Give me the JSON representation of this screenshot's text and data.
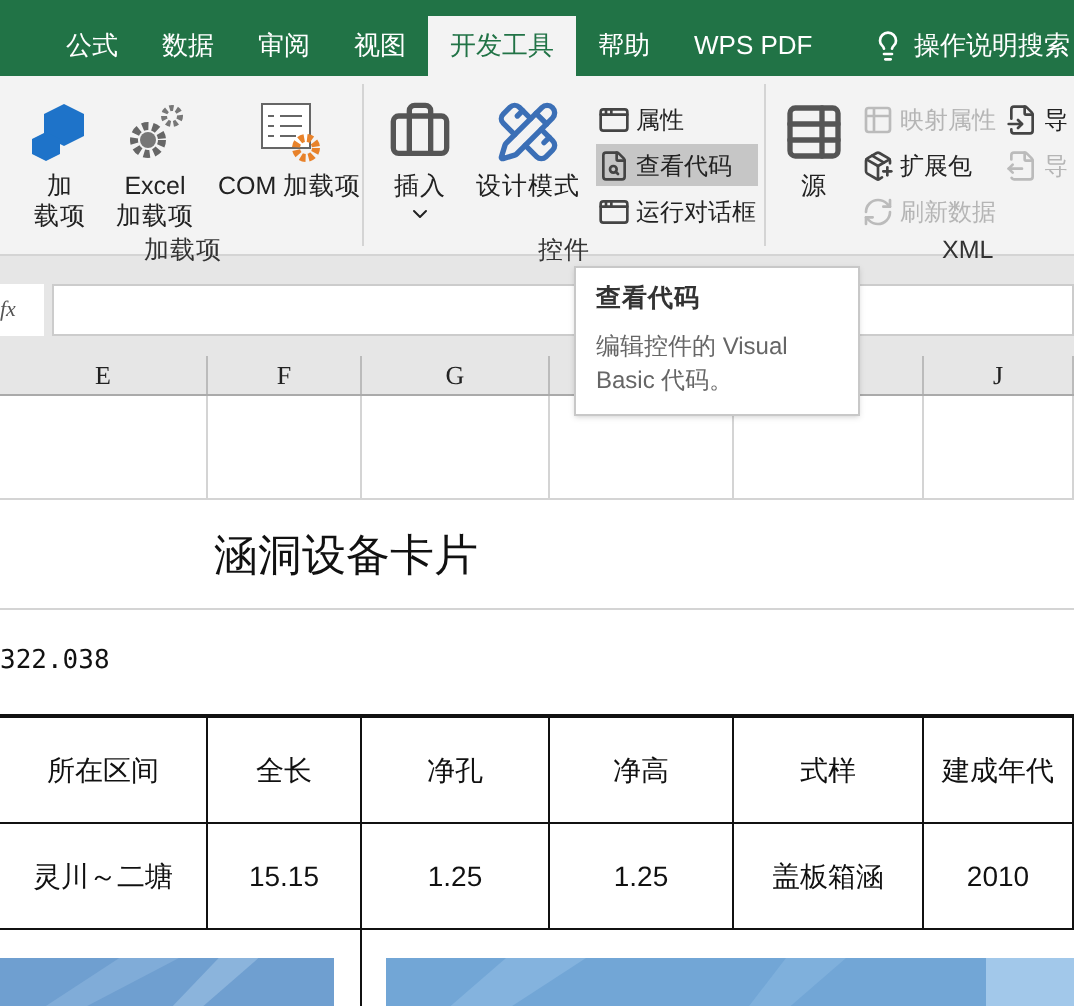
{
  "ribbon_tabs": [
    {
      "label": "公式",
      "selected": false
    },
    {
      "label": "数据",
      "selected": false
    },
    {
      "label": "审阅",
      "selected": false
    },
    {
      "label": "视图",
      "selected": false
    },
    {
      "label": "开发工具",
      "selected": true
    },
    {
      "label": "帮助",
      "selected": false
    },
    {
      "label": "WPS PDF",
      "selected": false
    }
  ],
  "search": {
    "label": "操作说明搜索"
  },
  "ribbon_groups": [
    {
      "label": "加载项",
      "buttons": [
        {
          "kind": "large",
          "lines": [
            "加",
            "载项"
          ]
        },
        {
          "kind": "large",
          "lines": [
            "Excel",
            "加载项"
          ]
        },
        {
          "kind": "large",
          "lines": [
            "COM 加载项"
          ]
        }
      ]
    },
    {
      "label": "控件",
      "buttons": [
        {
          "kind": "dropdown",
          "lines": [
            "插入"
          ]
        },
        {
          "kind": "large",
          "lines": [
            "设计模式"
          ]
        },
        {
          "kind": "small",
          "lines": [
            "属性"
          ],
          "selected": false,
          "disabled": false
        },
        {
          "kind": "small",
          "lines": [
            "查看代码"
          ],
          "selected": true,
          "disabled": false
        },
        {
          "kind": "small",
          "lines": [
            "运行对话框"
          ],
          "selected": false,
          "disabled": false
        }
      ]
    },
    {
      "label": "XML",
      "buttons": [
        {
          "kind": "large",
          "lines": [
            "源"
          ]
        },
        {
          "kind": "small",
          "lines": [
            "映射属性"
          ],
          "selected": false,
          "disabled": true
        },
        {
          "kind": "small",
          "lines": [
            "扩展包"
          ],
          "selected": false,
          "disabled": false
        },
        {
          "kind": "small",
          "lines": [
            "刷新数据"
          ],
          "selected": false,
          "disabled": true
        },
        {
          "kind": "small",
          "lines": [
            "导"
          ],
          "selected": false,
          "disabled": false
        },
        {
          "kind": "small",
          "lines": [
            "导"
          ],
          "selected": false,
          "disabled": true
        }
      ]
    }
  ],
  "formula_bar": {
    "label": "fx"
  },
  "tooltip": {
    "title": "查看代码",
    "text": "编辑控件的 Visual Basic 代码。"
  },
  "column_headers": [
    "E",
    "F",
    "G",
    "J"
  ],
  "sheet": {
    "title": "涵洞设备卡片",
    "value": "322.038",
    "table_header": [
      "所在区间",
      "全长",
      "净孔",
      "净高",
      "式样",
      "建成年代"
    ],
    "table_row": [
      "灵川～二塘",
      "15.15",
      "1.25",
      "1.25",
      "盖板箱涵",
      "2010"
    ]
  }
}
